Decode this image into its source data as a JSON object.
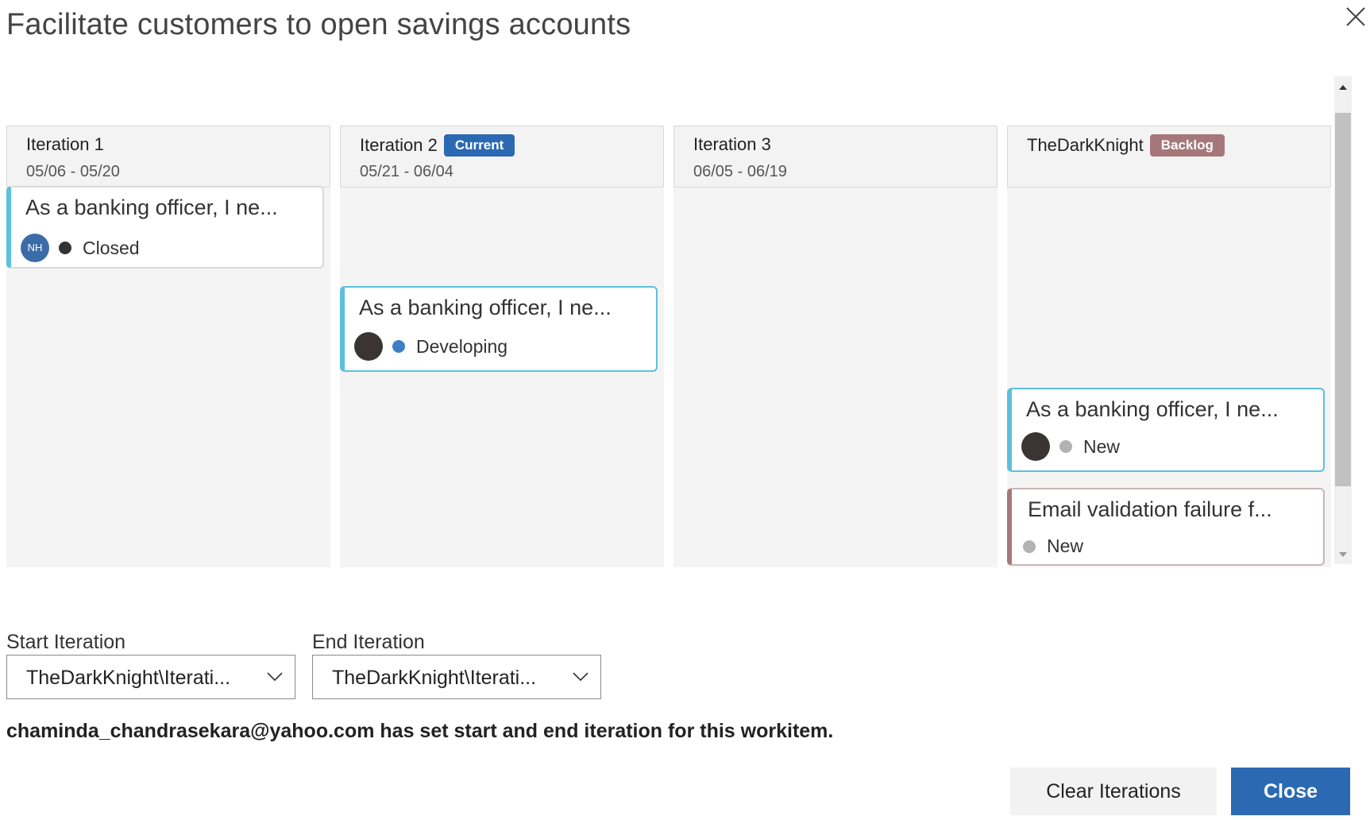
{
  "dialog": {
    "title": "Facilitate customers to open savings accounts",
    "close_icon": "close-icon"
  },
  "columns": [
    {
      "name": "Iteration 1",
      "dates": "05/06 - 05/20",
      "badge": ""
    },
    {
      "name": "Iteration 2",
      "dates": "05/21 - 06/04",
      "badge": "Current"
    },
    {
      "name": "Iteration 3",
      "dates": "06/05 - 06/19",
      "badge": ""
    },
    {
      "name": "TheDarkKnight",
      "dates": "",
      "badge": "Backlog"
    }
  ],
  "cards": [
    {
      "title": "As a banking officer, I ne...",
      "avatar": "NH",
      "state": "Closed",
      "state_color": "#333333",
      "accent": "#5bc0de"
    },
    {
      "title": "As a banking officer, I ne...",
      "avatar": "",
      "state": "Developing",
      "state_color": "#3d7fc7",
      "accent": "#5bc0de"
    },
    {
      "title": "As a banking officer, I ne...",
      "avatar": "",
      "state": "New",
      "state_color": "#b2b2b2",
      "accent": "#5bc0de"
    },
    {
      "title": "Email validation failure f...",
      "avatar": "",
      "state": "New",
      "state_color": "#b2b2b2",
      "accent": "#a6777a"
    }
  ],
  "fields": {
    "start_label": "Start Iteration",
    "start_value": "TheDarkKnight\\Iterati...",
    "end_label": "End Iteration",
    "end_value": "TheDarkKnight\\Iterati..."
  },
  "info_text": "chaminda_chandrasekara@yahoo.com has set start and end iteration for this workitem.",
  "buttons": {
    "clear": "Clear Iterations",
    "close": "Close"
  },
  "colors": {
    "primary": "#2b6ab3",
    "backlog": "#a6777a",
    "card_accent_blue": "#5bc0de"
  }
}
